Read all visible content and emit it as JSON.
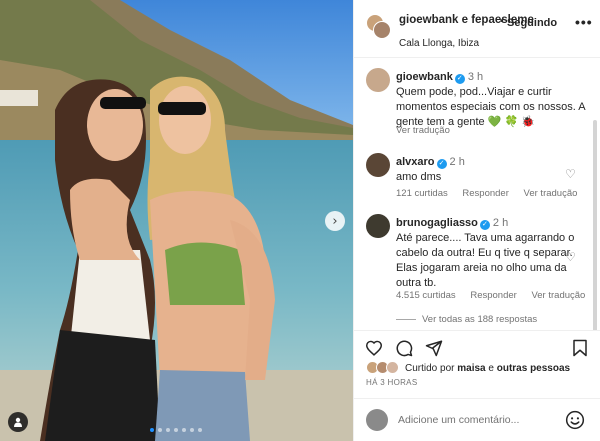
{
  "post": {
    "header": {
      "users": "gioewbank e fepaesleme",
      "separator": "•",
      "follow_label": "Seguindo",
      "location": "Cala Llonga, Ibiza",
      "more_label": "•••"
    },
    "comments": [
      {
        "username": "gioewbank",
        "verified": true,
        "time": "3 h",
        "text": "Quem pode, pod...Viajar e curtir momentos especiais com os nossos. A gente tem a gente 💚 🍀 🐞",
        "translate_label": "Ver tradução"
      },
      {
        "username": "alvxaro",
        "verified": true,
        "time": "2 h",
        "text": "amo dms",
        "likes_label": "121 curtidas",
        "reply_label": "Responder",
        "translate_label": "Ver tradução"
      },
      {
        "username": "brunogagliasso",
        "verified": true,
        "time": "2 h",
        "text": "Até parece.... Tava uma agarrando o cabelo da outra! Eu q tive q separar. Elas jogaram areia no olho uma da outra tb.",
        "likes_label": "4.515 curtidas",
        "reply_label": "Responder",
        "translate_label": "Ver tradução",
        "replies_label": "Ver todas as 188 respostas"
      }
    ],
    "liked_by": {
      "prefix": "Curtido por",
      "user": "maisa",
      "suffix": "e",
      "others": "outras pessoas"
    },
    "time_ago": "HÁ 3 HORAS",
    "add_comment_placeholder": "Adicione um comentário...",
    "carousel": {
      "slides": 7,
      "active_index": 0
    },
    "colors": {
      "verified": "#1d9bf0",
      "text": "#262626",
      "secondary_text": "#737373",
      "active_dot": "#1e90ff"
    }
  }
}
